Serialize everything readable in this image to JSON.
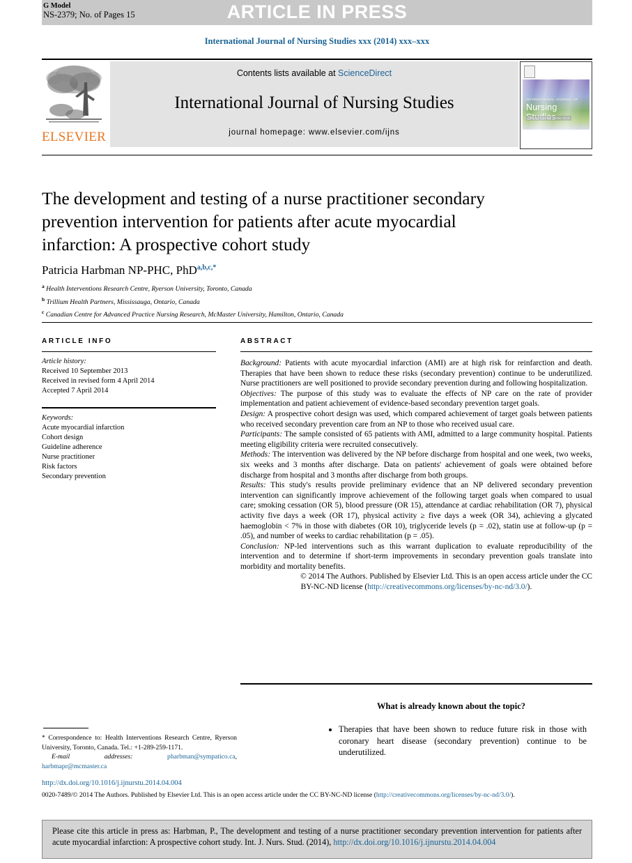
{
  "banner": {
    "g_model": "G Model",
    "article_id": "NS-2379; No. of Pages 15",
    "press_label": "ARTICLE IN PRESS"
  },
  "running_head": "International Journal of Nursing Studies xxx (2014) xxx–xxx",
  "masthead": {
    "contents_prefix": "Contents lists available at ",
    "sciencedirect": "ScienceDirect",
    "journal_name": "International Journal of Nursing Studies",
    "homepage": "journal homepage: www.elsevier.com/ijns",
    "publisher": "ELSEVIER",
    "cover_small_text": "INTERNATIONAL JOURNAL OF",
    "cover_main_text": "Nursing Studies",
    "cover_sub_text": "Official Journal of the RCN"
  },
  "article": {
    "title": "The development and testing of a nurse practitioner secondary prevention intervention for patients after acute myocardial infarction: A prospective cohort study",
    "author": "Patricia Harbman NP-PHC, PhD",
    "author_superscripts": "a,b,c,*",
    "affiliations": [
      {
        "marker": "a",
        "text": "Health Interventions Research Centre, Ryerson University, Toronto, Canada"
      },
      {
        "marker": "b",
        "text": "Trillium Health Partners, Mississauga, Ontario, Canada"
      },
      {
        "marker": "c",
        "text": "Canadian Centre for Advanced Practice Nursing Research, McMaster University, Hamilton, Ontario, Canada"
      }
    ]
  },
  "article_info": {
    "heading": "ARTICLE INFO",
    "history_label": "Article history:",
    "history": [
      "Received 10 September 2013",
      "Received in revised form 4 April 2014",
      "Accepted 7 April 2014"
    ],
    "keywords_label": "Keywords:",
    "keywords": [
      "Acute myocardial infarction",
      "Cohort design",
      "Guideline adherence",
      "Nurse practitioner",
      "Risk factors",
      "Secondary prevention"
    ]
  },
  "abstract": {
    "heading": "ABSTRACT",
    "sections": [
      {
        "label": "Background:",
        "text": " Patients with acute myocardial infarction (AMI) are at high risk for reinfarction and death. Therapies that have been shown to reduce these risks (secondary prevention) continue to be underutilized. Nurse practitioners are well positioned to provide secondary prevention during and following hospitalization."
      },
      {
        "label": "Objectives:",
        "text": " The purpose of this study was to evaluate the effects of NP care on the rate of provider implementation and patient achievement of evidence-based secondary prevention target goals."
      },
      {
        "label": "Design:",
        "text": " A prospective cohort design was used, which compared achievement of target goals between patients who received secondary prevention care from an NP to those who received usual care."
      },
      {
        "label": "Participants:",
        "text": " The sample consisted of 65 patients with AMI, admitted to a large community hospital. Patients meeting eligibility criteria were recruited consecutively."
      },
      {
        "label": "Methods:",
        "text": " The intervention was delivered by the NP before discharge from hospital and one week, two weeks, six weeks and 3 months after discharge. Data on patients' achievement of goals were obtained before discharge from hospital and 3 months after discharge from both groups."
      },
      {
        "label": "Results:",
        "text": " This study's results provide preliminary evidence that an NP delivered secondary prevention intervention can significantly improve achievement of the following target goals when compared to usual care; smoking cessation (OR 5), blood pressure (OR 15), attendance at cardiac rehabilitation (OR 7), physical activity five days a week (OR 17), physical activity ≥ five days a week (OR 34), achieving a glycated haemoglobin < 7% in those with diabetes (OR 10), triglyceride levels (p = .02), statin use at follow-up (p = .05), and number of weeks to cardiac rehabilitation (p = .05)."
      },
      {
        "label": "Conclusion:",
        "text": " NP-led interventions such as this warrant duplication to evaluate reproducibility of the intervention and to determine if short-term improvements in secondary prevention goals translate into morbidity and mortality benefits."
      }
    ],
    "copyright_line1": "© 2014 The Authors. Published by Elsevier Ltd. This is an open access article under the CC",
    "copyright_line2_prefix": "BY-NC-ND license (",
    "copyright_license_url": "http://creativecommons.org/licenses/by-nc-nd/3.0/",
    "copyright_line2_suffix": ")."
  },
  "known_box": {
    "heading": "What is already known about the topic?",
    "items": [
      "Therapies that have been shown to reduce future risk in those with coronary heart disease (secondary prevention) continue to be underutilized."
    ]
  },
  "footnote": {
    "marker": "*",
    "correspondence": "Correspondence to: Health Interventions Research Centre, Ryerson University, Toronto, Canada. Tel.: +1-289-259-1171.",
    "email_label": "E-mail addresses:",
    "emails": [
      "pharbman@sympatico.ca",
      "harbmapr@mcmaster.ca"
    ]
  },
  "bottom": {
    "doi": "http://dx.doi.org/10.1016/j.ijnurstu.2014.04.004",
    "issn_prefix": "0020-7489/",
    "issn_text": "© 2014 The Authors. Published by Elsevier Ltd. This is an open access article under the CC BY-NC-ND license (",
    "issn_link": "http://creativecommons.org/licenses/by-nc-nd/3.0/",
    "issn_suffix": ")."
  },
  "cite_box": {
    "text_prefix": "Please cite this article in press as: Harbman, P., The development and testing of a nurse practitioner secondary prevention intervention for patients after acute myocardial infarction: A prospective cohort study. Int. J. Nurs. Stud. (2014), ",
    "doi_link": "http://dx.doi.org/10.1016/j.ijnurstu.2014.04.004"
  },
  "colors": {
    "link_blue": "#1a6496",
    "banner_gray": "#c8c8c8",
    "masthead_gray": "#e3e3e3",
    "elsevier_orange": "#e87722",
    "cite_box_gray": "#d4d4d4"
  }
}
